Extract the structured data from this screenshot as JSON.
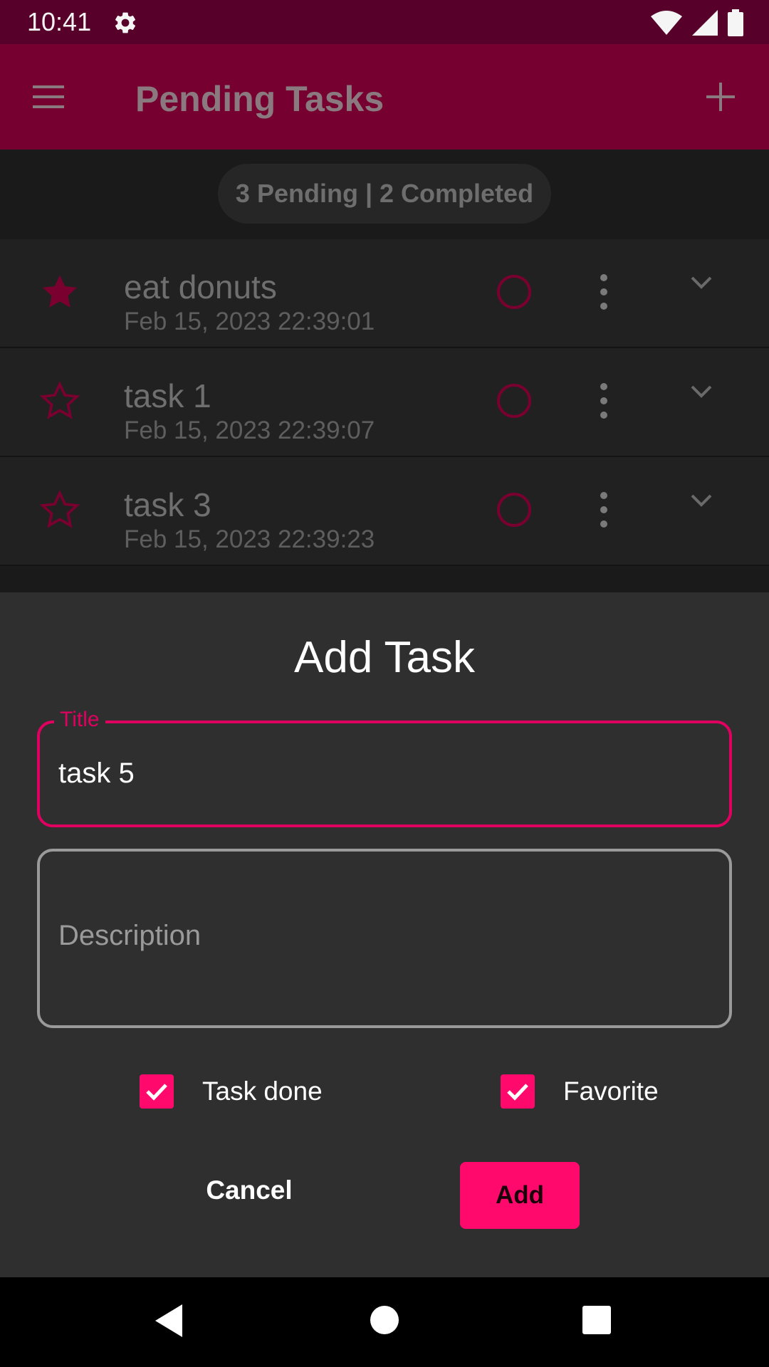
{
  "status_bar": {
    "time": "10:41"
  },
  "app_bar": {
    "title": "Pending Tasks"
  },
  "summary": {
    "text": "3 Pending | 2 Completed"
  },
  "tasks": [
    {
      "title": "eat donuts",
      "date": "Feb 15, 2023 22:39:01",
      "favorite": true
    },
    {
      "title": "task 1",
      "date": "Feb 15, 2023 22:39:07",
      "favorite": false
    },
    {
      "title": "task 3",
      "date": "Feb 15, 2023 22:39:23",
      "favorite": false
    }
  ],
  "dialog": {
    "title": "Add Task",
    "title_field": {
      "label": "Title",
      "value": "task 5"
    },
    "description_field": {
      "placeholder": "Description",
      "value": ""
    },
    "task_done": {
      "label": "Task done",
      "checked": true
    },
    "favorite": {
      "label": "Favorite",
      "checked": true
    },
    "cancel_label": "Cancel",
    "add_label": "Add"
  },
  "colors": {
    "accent": "#ff0a6c",
    "app_bar": "#76002f",
    "status_bar": "#56002a",
    "sheet": "#2f2f2f"
  },
  "icons": [
    "settings-icon",
    "wifi-icon",
    "signal-icon",
    "battery-icon",
    "menu-icon",
    "add-icon",
    "star-icon",
    "circle-icon",
    "more-vert-icon",
    "chevron-down-icon",
    "check-icon",
    "back-icon",
    "home-icon",
    "recents-icon"
  ]
}
